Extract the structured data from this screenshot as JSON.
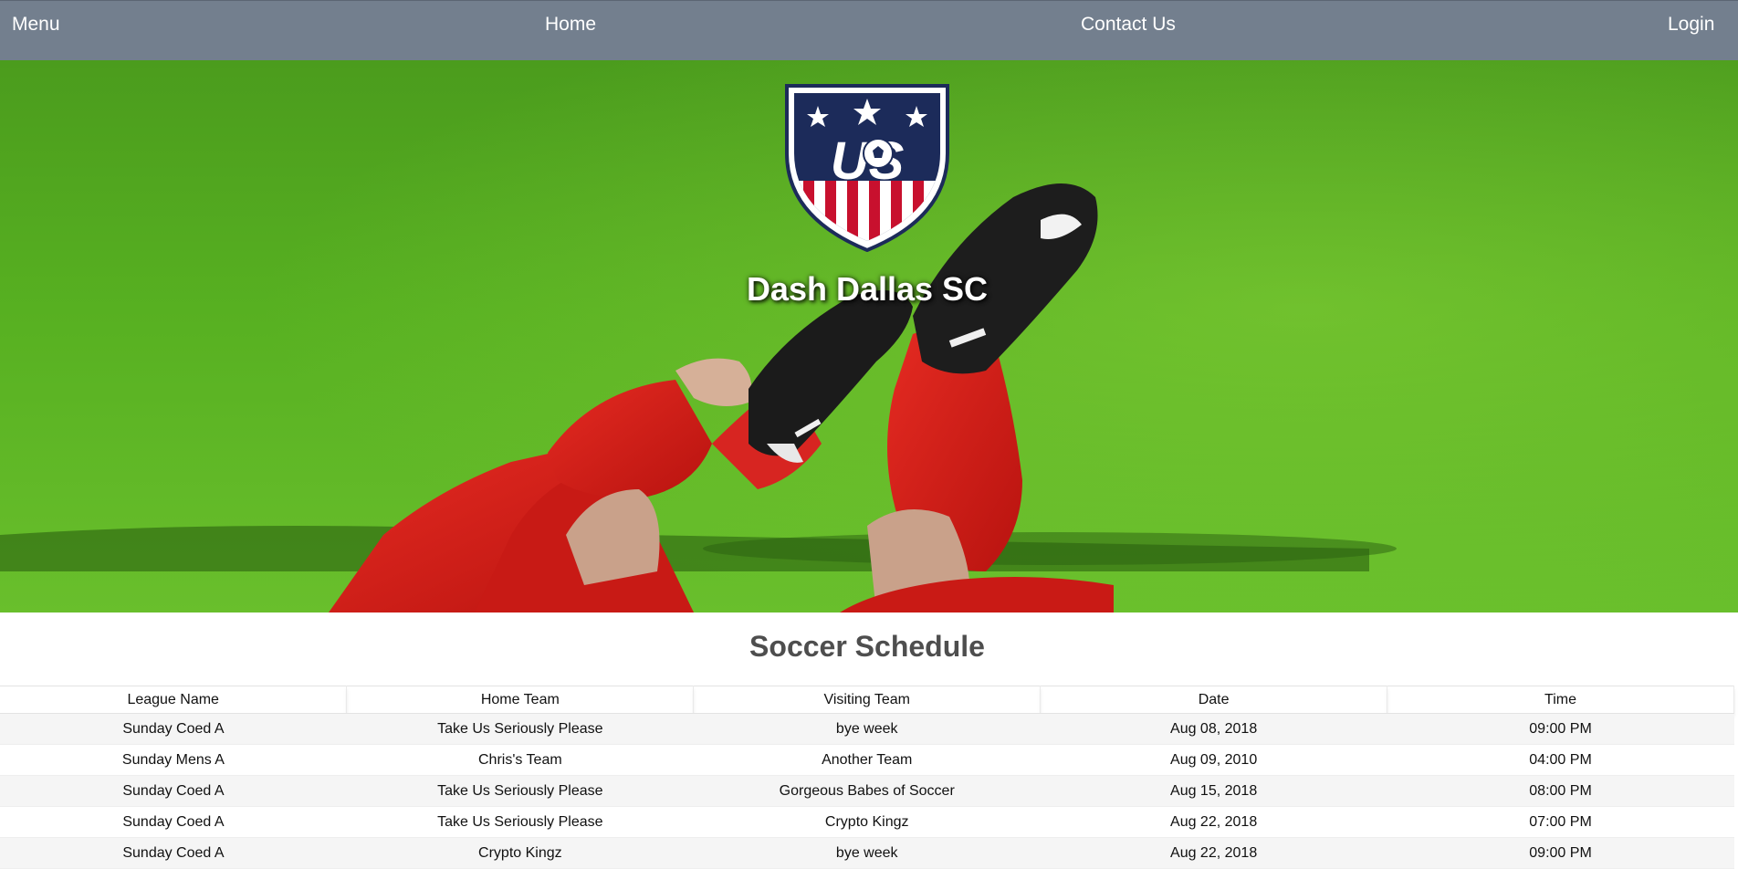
{
  "nav": {
    "menu": "Menu",
    "home": "Home",
    "contact": "Contact Us",
    "login": "Login"
  },
  "hero": {
    "club_name": "Dash Dallas SC",
    "crest_text": "US"
  },
  "schedule": {
    "title": "Soccer Schedule",
    "columns": [
      "League Name",
      "Home Team",
      "Visiting Team",
      "Date",
      "Time"
    ],
    "rows": [
      [
        "Sunday Coed A",
        "Take Us Seriously Please",
        "bye week",
        "Aug 08, 2018",
        "09:00 PM"
      ],
      [
        "Sunday Mens A",
        "Chris's Team",
        "Another Team",
        "Aug 09, 2010",
        "04:00 PM"
      ],
      [
        "Sunday Coed A",
        "Take Us Seriously Please",
        "Gorgeous Babes of Soccer",
        "Aug 15, 2018",
        "08:00 PM"
      ],
      [
        "Sunday Coed A",
        "Take Us Seriously Please",
        "Crypto Kingz",
        "Aug 22, 2018",
        "07:00 PM"
      ],
      [
        "Sunday Coed A",
        "Crypto Kingz",
        "bye week",
        "Aug 22, 2018",
        "09:00 PM"
      ]
    ]
  },
  "colors": {
    "navbar": "#737f8e",
    "grass": "#3f8f1a",
    "kit_red": "#d8201f",
    "crest_navy": "#1c2b5a",
    "crest_red": "#c8102e",
    "title_gray": "#4e4e4e"
  }
}
